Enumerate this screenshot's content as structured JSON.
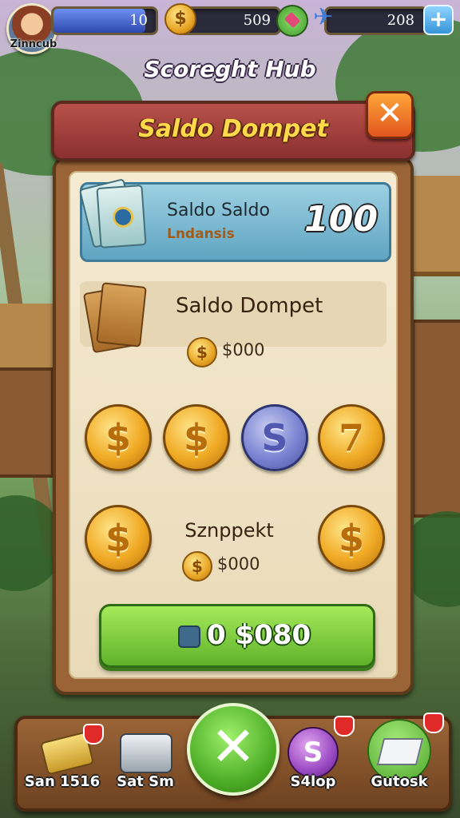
{
  "hud": {
    "player_name": "Zinncub",
    "level_value": "10",
    "level_progress": 0.9,
    "coins": "509",
    "energy": "208",
    "coin_icon": "$",
    "plus_label": "+"
  },
  "hub_title": "Scoreght Hub",
  "panel": {
    "title": "Saldo Dompet",
    "close_label": "✕",
    "balance": {
      "label": "Saldo Saldo",
      "sub": "Lndansis",
      "value": "100"
    },
    "wallet": {
      "title": "Saldo Dompet",
      "amount": "$000"
    },
    "coins_row": [
      "$",
      "$",
      "S",
      "7"
    ],
    "snapshot": {
      "label": "Sznppekt",
      "amount": "$000"
    },
    "action_button": "0 $080"
  },
  "nav": {
    "items": [
      {
        "label": "San 1516"
      },
      {
        "label": "Sat Sm"
      },
      {
        "label": "S4lop"
      },
      {
        "label": "Gutosk"
      }
    ],
    "center_label": "✕"
  },
  "colors": {
    "accent_gold": "#ffd94a",
    "header_red": "#8b2f30",
    "button_green": "#5fb22a"
  }
}
